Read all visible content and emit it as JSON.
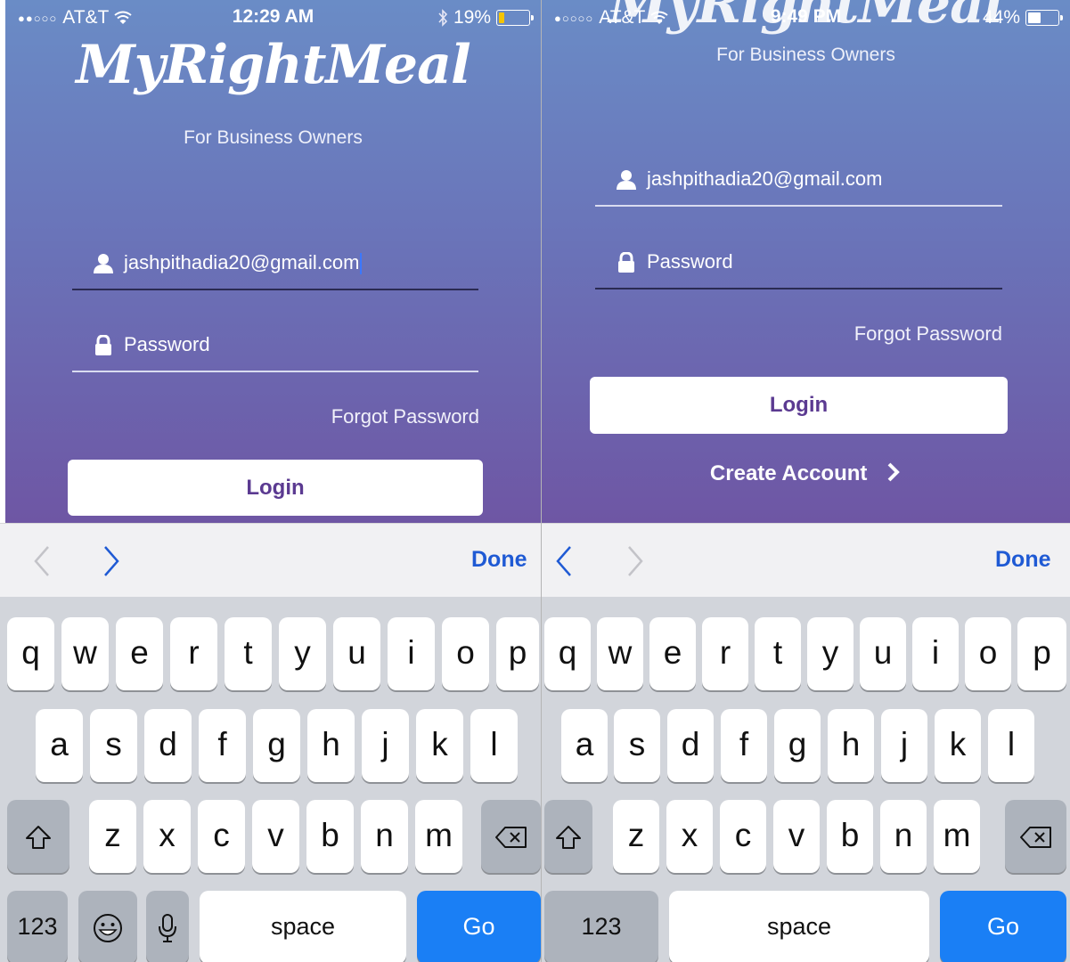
{
  "left": {
    "status": {
      "carrier": "AT&T",
      "time": "12:29 AM",
      "battery": "19%"
    },
    "logo": "MyRightMeal",
    "subtitle": "For Business Owners",
    "email": {
      "value": "jashpithadia20@gmail.com"
    },
    "password": {
      "placeholder": "Password"
    },
    "forgot": "Forgot Password",
    "login": "Login",
    "toolbar": {
      "done": "Done"
    },
    "keys": {
      "numbers": "123",
      "space": "space",
      "go": "Go"
    }
  },
  "right": {
    "status": {
      "carrier": "AT&T",
      "time": "9:49 PM",
      "battery": "44%"
    },
    "logo": "MyRightMeal",
    "subtitle": "For Business Owners",
    "email": {
      "value": "jashpithadia20@gmail.com"
    },
    "password": {
      "placeholder": "Password"
    },
    "forgot": "Forgot Password",
    "login": "Login",
    "create": "Create Account",
    "toolbar": {
      "done": "Done"
    },
    "keys": {
      "numbers": "123",
      "space": "space",
      "go": "Go"
    }
  },
  "keyboard_rows": {
    "row1": [
      "q",
      "w",
      "e",
      "r",
      "t",
      "y",
      "u",
      "i",
      "o",
      "p"
    ],
    "row2": [
      "a",
      "s",
      "d",
      "f",
      "g",
      "h",
      "j",
      "k",
      "l"
    ],
    "row3": [
      "z",
      "x",
      "c",
      "v",
      "b",
      "n",
      "m"
    ]
  },
  "colors": {
    "accent": "#1a7ff5",
    "login_text": "#5b3a91",
    "toolbar_done": "#1f5ad4",
    "battery_low": "#f5c400",
    "battery_normal": "#ffffff"
  },
  "icons": [
    "wifi-icon",
    "bluetooth-icon",
    "battery-icon",
    "user-icon",
    "lock-icon",
    "chevron-left-icon",
    "chevron-right-icon",
    "shift-icon",
    "backspace-icon",
    "emoji-icon",
    "microphone-icon"
  ]
}
